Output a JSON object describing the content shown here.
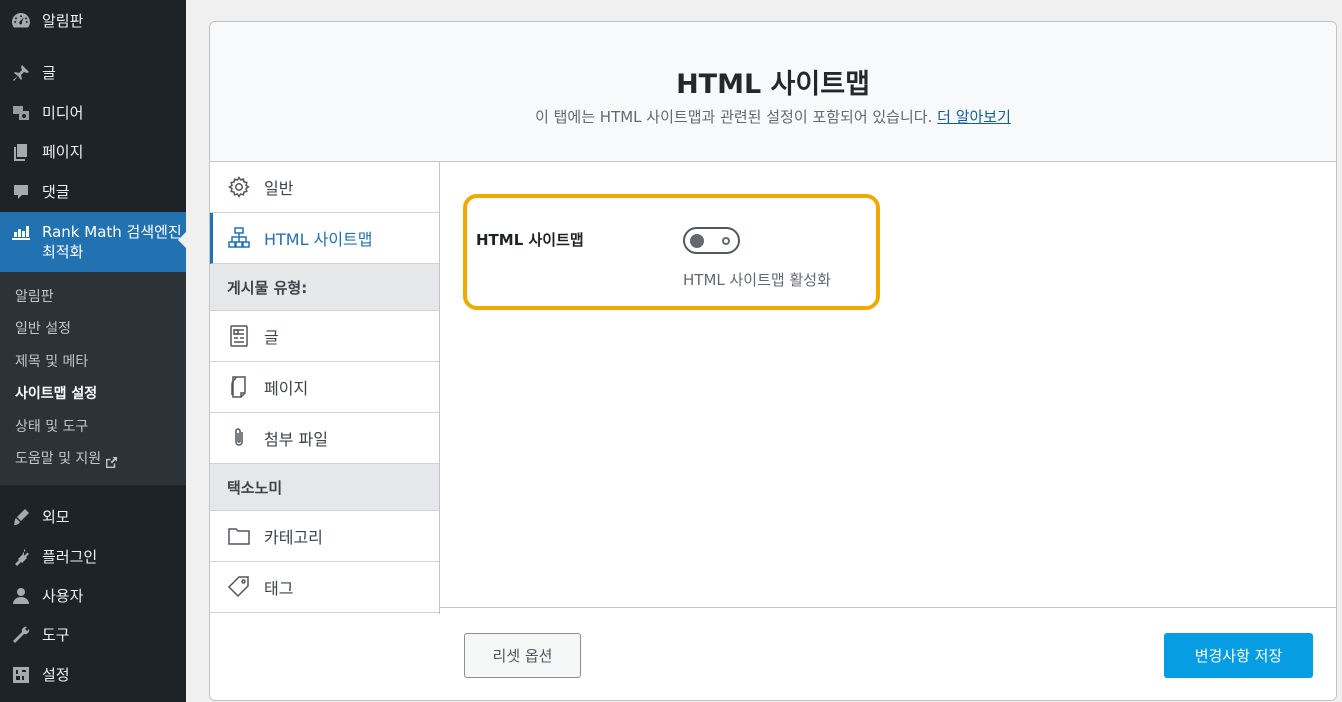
{
  "sidebar": {
    "menu": [
      {
        "label": "알림판",
        "icon": "dashboard-icon"
      },
      {
        "label": "글",
        "icon": "pin-icon"
      },
      {
        "label": "미디어",
        "icon": "media-icon"
      },
      {
        "label": "페이지",
        "icon": "pages-icon"
      },
      {
        "label": "댓글",
        "icon": "comments-icon"
      },
      {
        "label": "Rank Math 검색엔진 최적화",
        "icon": "rank-math-icon"
      },
      {
        "label": "외모",
        "icon": "appearance-icon"
      },
      {
        "label": "플러그인",
        "icon": "plugins-icon"
      },
      {
        "label": "사용자",
        "icon": "users-icon"
      },
      {
        "label": "도구",
        "icon": "tools-icon"
      },
      {
        "label": "설정",
        "icon": "settings-icon"
      }
    ],
    "submenu": [
      {
        "label": "알림판"
      },
      {
        "label": "일반 설정"
      },
      {
        "label": "제목 및 메타"
      },
      {
        "label": "사이트맵 설정"
      },
      {
        "label": "상태 및 도구"
      },
      {
        "label": "도움말 및 지원"
      }
    ]
  },
  "header": {
    "title": "HTML 사이트맵",
    "description": "이 탭에는 HTML 사이트맵과 관련된 설정이 포함되어 있습니다.",
    "learn_more": "더 알아보기"
  },
  "tabs": {
    "general": "일반",
    "html_sitemap": "HTML 사이트맵",
    "post_types_heading": "게시물 유형:",
    "posts": "글",
    "pages": "페이지",
    "attachments": "첨부 파일",
    "taxonomies_heading": "택소노미",
    "categories": "카테고리",
    "tags": "태그"
  },
  "setting": {
    "label": "HTML 사이트맵",
    "toggle_state": "off",
    "description": "HTML 사이트맵 활성화"
  },
  "footer": {
    "reset": "리셋 옵션",
    "save": "변경사항 저장"
  },
  "colors": {
    "accent": "#2271b1",
    "highlight": "#f0a900",
    "save_button": "#069de3",
    "sidebar_bg": "#1d2327"
  }
}
